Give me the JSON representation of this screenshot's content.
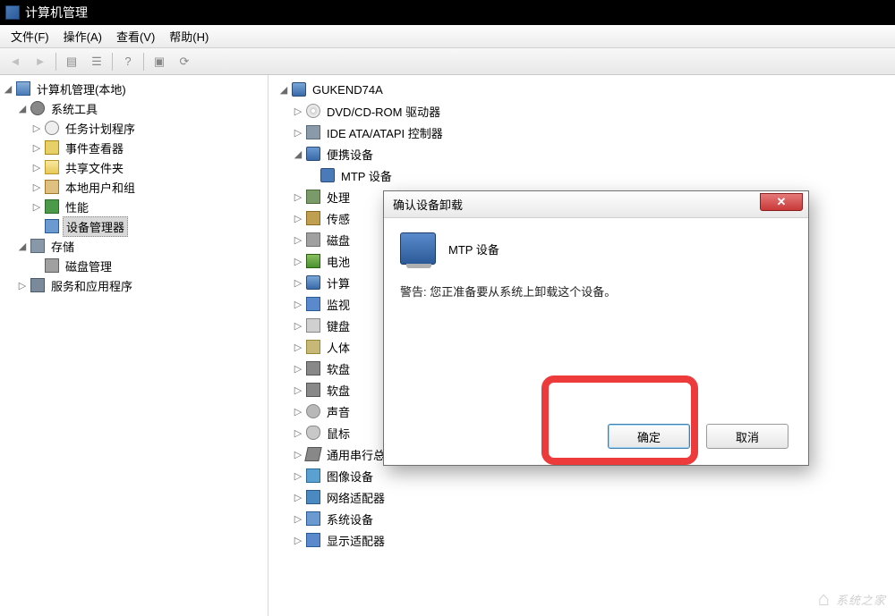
{
  "titlebar": {
    "title": "计算机管理"
  },
  "menubar": {
    "file": "文件(F)",
    "action": "操作(A)",
    "view": "查看(V)",
    "help": "帮助(H)"
  },
  "left_tree": {
    "root": "计算机管理(本地)",
    "sys_tools": "系统工具",
    "task_scheduler": "任务计划程序",
    "event_viewer": "事件查看器",
    "shared_folders": "共享文件夹",
    "local_users": "本地用户和组",
    "performance": "性能",
    "device_manager": "设备管理器",
    "storage": "存储",
    "disk_mgmt": "磁盘管理",
    "services_apps": "服务和应用程序"
  },
  "right_tree": {
    "computer": "GUKEND74A",
    "dvd": "DVD/CD-ROM 驱动器",
    "ide": "IDE ATA/ATAPI 控制器",
    "portable": "便携设备",
    "mtp": "MTP 设备",
    "cpu": "处理",
    "sensor": "传感",
    "disk": "磁盘",
    "battery": "电池",
    "computer2": "计算",
    "monitor": "监视",
    "keyboard": "键盘",
    "hid": "人体",
    "floppy1": "软盘",
    "floppy2": "软盘",
    "sound": "声音",
    "mouse": "鼠标",
    "usb": "通用串行总线控制器",
    "imaging": "图像设备",
    "network": "网络适配器",
    "system": "系统设备",
    "display": "显示适配器"
  },
  "dialog": {
    "title": "确认设备卸载",
    "device_name": "MTP 设备",
    "warning": "警告: 您正准备要从系统上卸载这个设备。",
    "ok": "确定",
    "cancel": "取消"
  },
  "watermark": "系统之家"
}
